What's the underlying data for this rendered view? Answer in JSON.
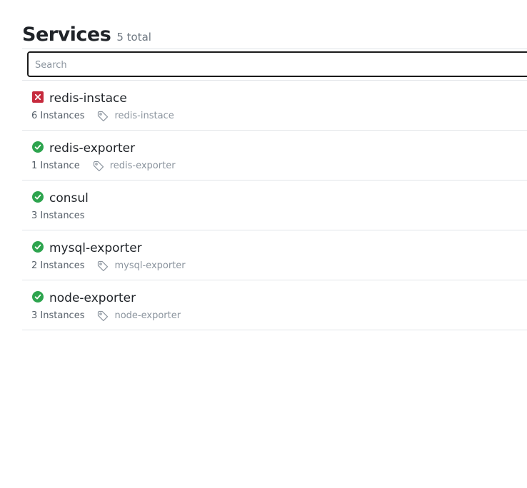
{
  "header": {
    "title": "Services",
    "total": "5 total"
  },
  "search": {
    "placeholder": "Search",
    "value": ""
  },
  "colors": {
    "passing": "#2da44e",
    "critical": "#c62a3d",
    "divider": "#e1e4e8"
  },
  "services": [
    {
      "name": "redis-instace",
      "status": "critical",
      "status_icon": "x-square-icon",
      "instances": "6 Instances",
      "tag": "redis-instace"
    },
    {
      "name": "redis-exporter",
      "status": "passing",
      "status_icon": "check-circle-icon",
      "instances": "1 Instance",
      "tag": "redis-exporter"
    },
    {
      "name": "consul",
      "status": "passing",
      "status_icon": "check-circle-icon",
      "instances": "3 Instances",
      "tag": ""
    },
    {
      "name": "mysql-exporter",
      "status": "passing",
      "status_icon": "check-circle-icon",
      "instances": "2 Instances",
      "tag": "mysql-exporter"
    },
    {
      "name": "node-exporter",
      "status": "passing",
      "status_icon": "check-circle-icon",
      "instances": "3 Instances",
      "tag": "node-exporter"
    }
  ]
}
